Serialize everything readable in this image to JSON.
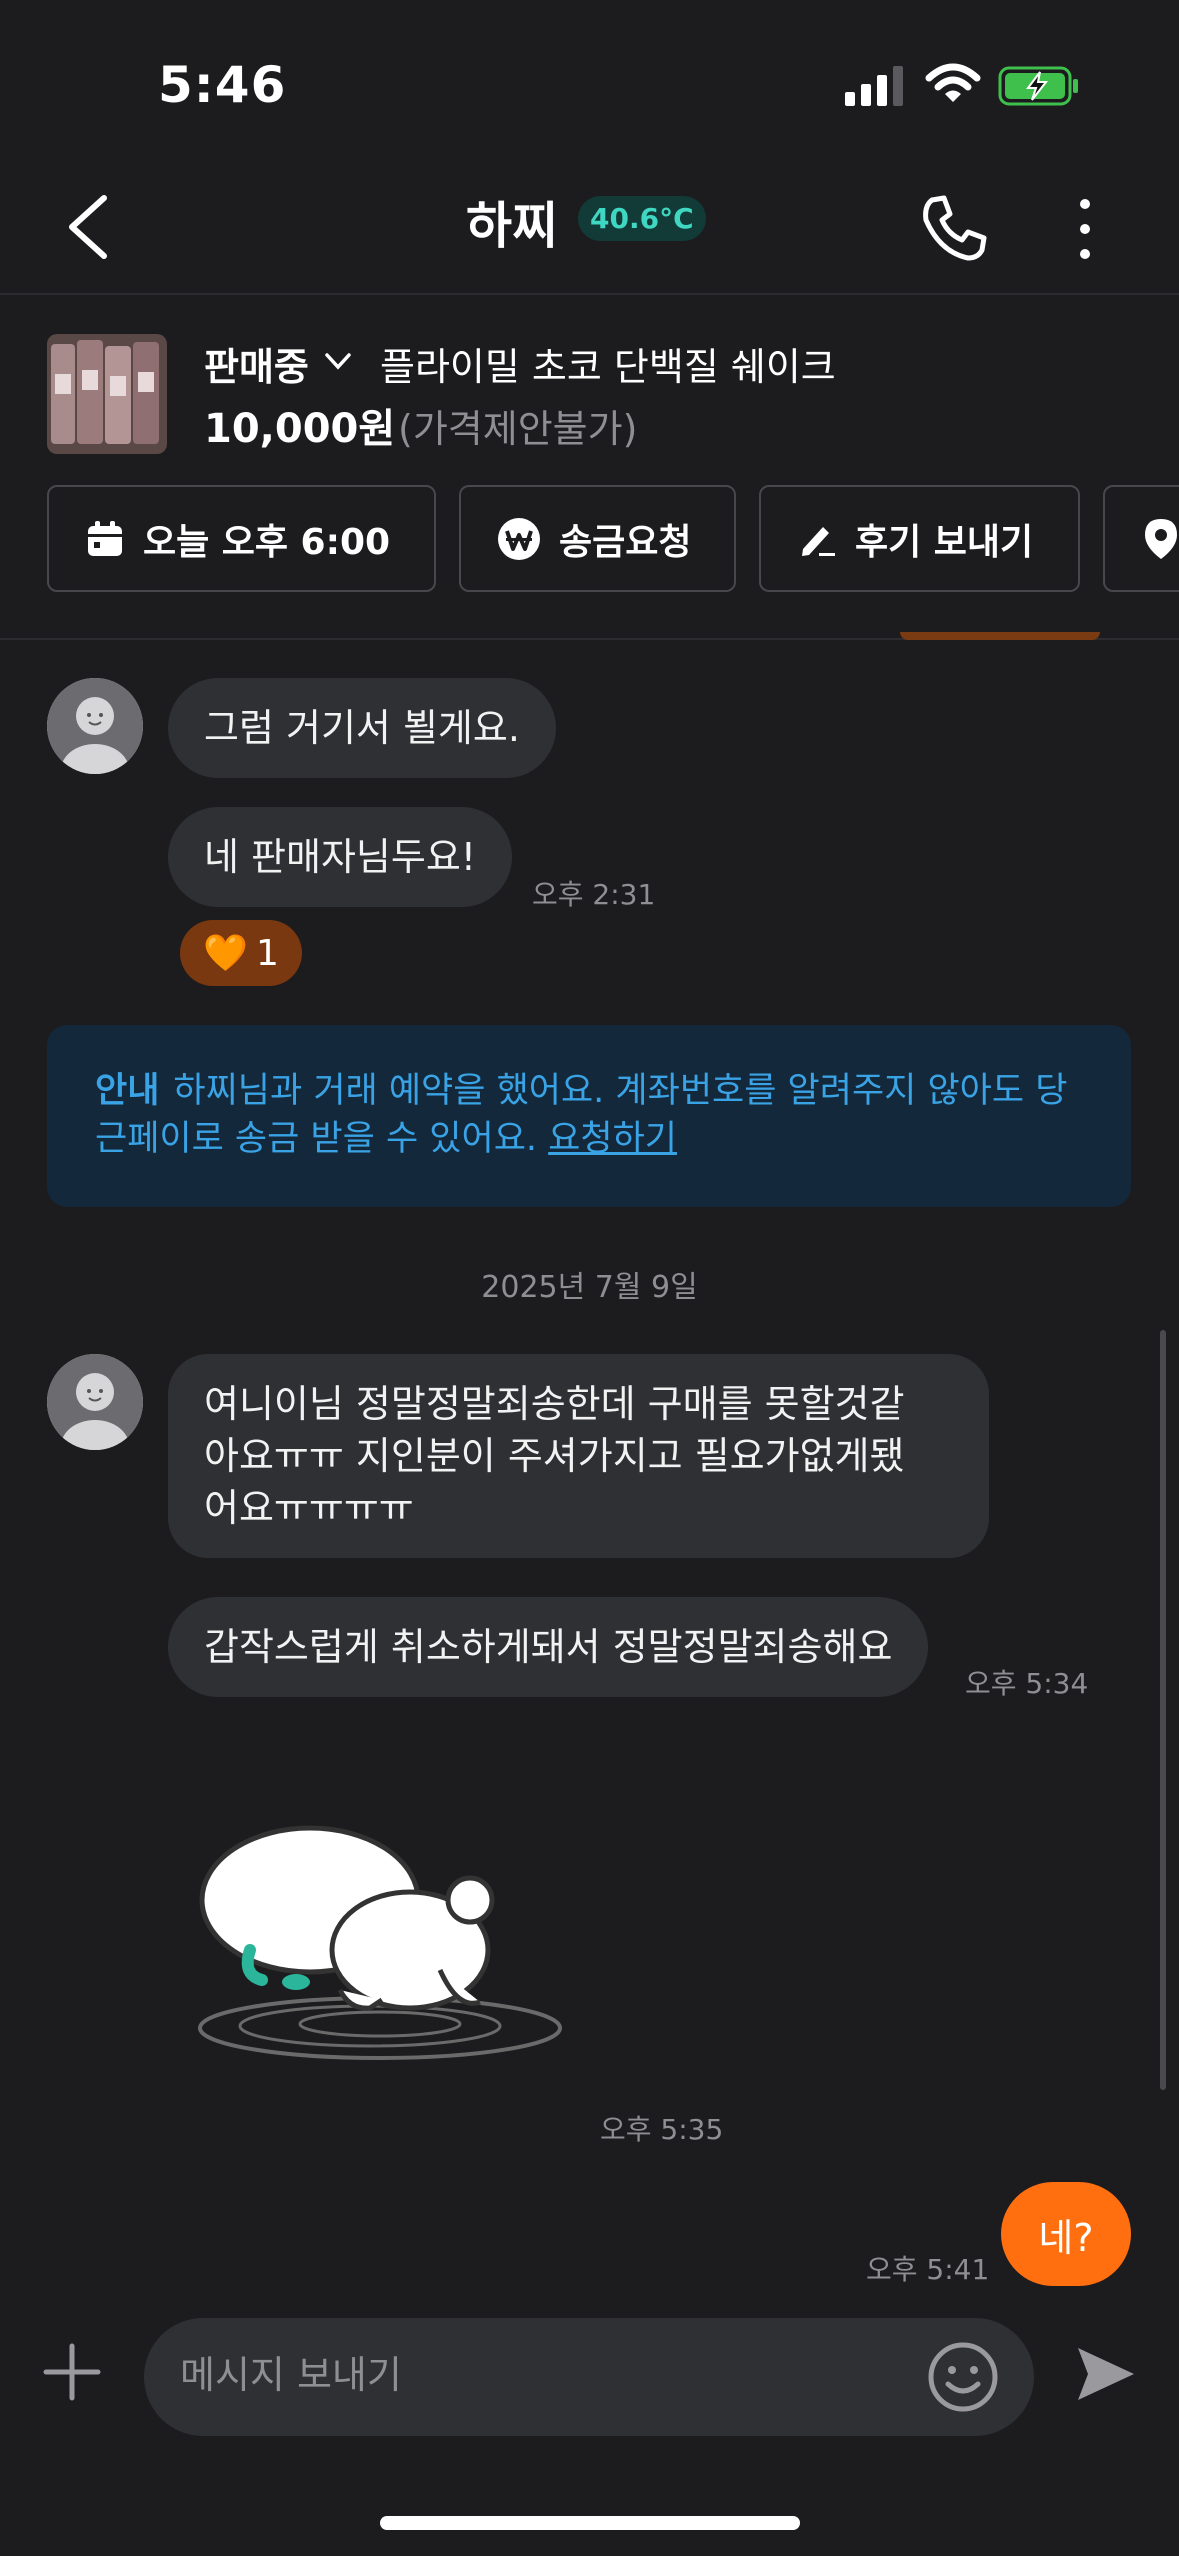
{
  "status_bar": {
    "time": "5:46"
  },
  "header": {
    "title": "하찌",
    "temperature": "40.6°C",
    "temp_color": "#3fd7c1"
  },
  "product": {
    "status": "판매중",
    "name": "플라이밀 초코 단백질 쉐이크",
    "price": "10,000원",
    "price_note": "(가격제안불가)"
  },
  "actions": [
    {
      "label": "오늘 오후 6:00",
      "icon": "calendar-icon"
    },
    {
      "label": "송금요청",
      "icon": "won-icon"
    },
    {
      "label": "후기 보내기",
      "icon": "pencil-icon"
    },
    {
      "label": "",
      "icon": "location-pin-icon"
    }
  ],
  "messages": [
    {
      "text": "그럼 거기서 뵐게요."
    },
    {
      "text": "네 판매자님두요!",
      "time": "오후 2:31",
      "reaction": {
        "emoji": "🧡",
        "count": "1"
      }
    },
    {
      "text": "여니이님 정말정말죄송한데 구매를 못할것같\n아요ㅠㅠ 지인분이 주셔가지고 필요가없게됐\n어요ㅠㅠㅠㅠ"
    },
    {
      "text": "갑작스럽게 취소하게돼서 정말정말죄송해요",
      "time": "오후 5:34"
    },
    {
      "sticker": "crying-bunny-sticker",
      "time": "오후 5:35"
    },
    {
      "text": "네?",
      "time": "오후 5:41",
      "mine": true
    }
  ],
  "notice": {
    "label": "안내",
    "text": "하찌님과 거래 예약을 했어요. 계좌번호를 알려주지 않아도 당근페이로 송금 받을 수 있어요.",
    "link": "요청하기"
  },
  "date_separator": "2025년 7월 9일",
  "composer": {
    "placeholder": "메시지 보내기"
  },
  "colors": {
    "accent": "#ff6f0f",
    "background": "#1c1c1f",
    "bubble": "#2f3034"
  }
}
